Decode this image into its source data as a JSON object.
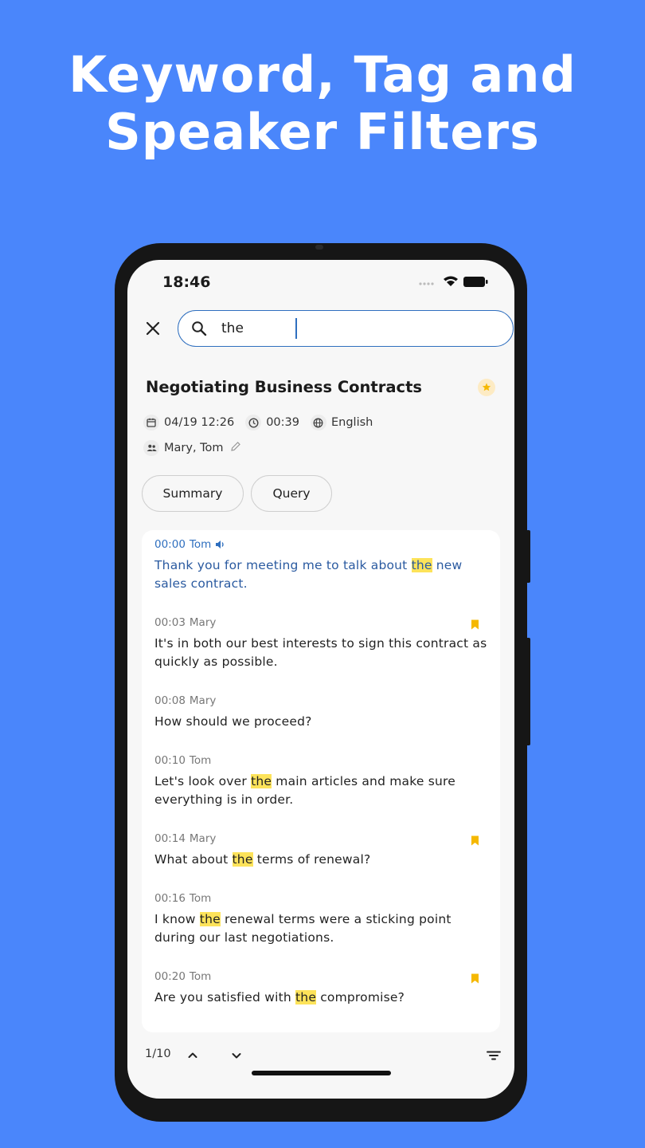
{
  "headline": {
    "line1": "Keyword, Tag and",
    "line2": "Speaker Filters"
  },
  "status_bar": {
    "time": "18:46"
  },
  "search": {
    "value": "the"
  },
  "recording": {
    "title": "Negotiating Business Contracts",
    "date": "04/19 12:26",
    "duration": "00:39",
    "language": "English",
    "speakers": "Mary, Tom"
  },
  "tabs": [
    {
      "label": "Summary"
    },
    {
      "label": "Query"
    }
  ],
  "transcript": [
    {
      "time": "00:00",
      "speaker": "Tom",
      "active": true,
      "bookmarked": false,
      "parts": [
        {
          "t": "Thank you for meeting me to talk about "
        },
        {
          "t": "the",
          "hl": true
        },
        {
          "t": " new sales contract."
        }
      ]
    },
    {
      "time": "00:03",
      "speaker": "Mary",
      "active": false,
      "bookmarked": true,
      "parts": [
        {
          "t": "It's in both our best interests to sign this contract as quickly as possible."
        }
      ]
    },
    {
      "time": "00:08",
      "speaker": "Mary",
      "active": false,
      "bookmarked": false,
      "parts": [
        {
          "t": "How should we proceed?"
        }
      ]
    },
    {
      "time": "00:10",
      "speaker": "Tom",
      "active": false,
      "bookmarked": false,
      "parts": [
        {
          "t": "Let's look over "
        },
        {
          "t": "the",
          "hl": true
        },
        {
          "t": " main articles and make sure everything is in order."
        }
      ]
    },
    {
      "time": "00:14",
      "speaker": "Mary",
      "active": false,
      "bookmarked": true,
      "parts": [
        {
          "t": "What about "
        },
        {
          "t": "the",
          "hl": true
        },
        {
          "t": " terms of renewal?"
        }
      ]
    },
    {
      "time": "00:16",
      "speaker": "Tom",
      "active": false,
      "bookmarked": false,
      "parts": [
        {
          "t": "I know "
        },
        {
          "t": "the",
          "hl": true
        },
        {
          "t": " renewal terms were a sticking point during our last negotiations."
        }
      ]
    },
    {
      "time": "00:20",
      "speaker": "Tom",
      "active": false,
      "bookmarked": true,
      "parts": [
        {
          "t": "Are you satisfied with "
        },
        {
          "t": "the",
          "hl": true
        },
        {
          "t": " compromise?"
        }
      ]
    }
  ],
  "navigation": {
    "match_position": "1/10"
  },
  "colors": {
    "background": "#4a86fb",
    "accent": "#2f6fbf",
    "highlight": "#fde35a",
    "bookmark": "#f5b800"
  }
}
